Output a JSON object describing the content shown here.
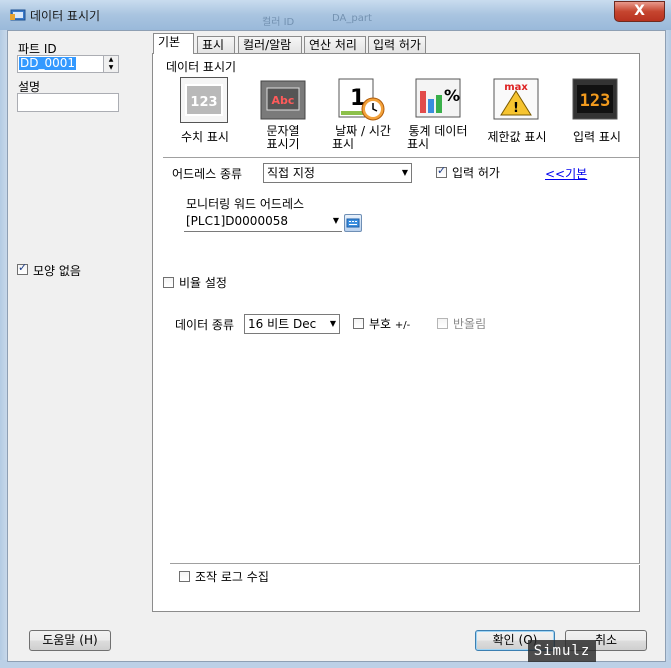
{
  "window": {
    "title": "데이터 표시기",
    "close": "X",
    "bg_ghost_1": "컬러 ID",
    "bg_ghost_2": "DA_part"
  },
  "left": {
    "part_id_label": "파트 ID",
    "part_id_value": "DD_0001",
    "desc_label": "설명",
    "desc_value": "",
    "no_shape_label": "모양 없음",
    "no_shape_checked": true
  },
  "tabs": [
    "기본",
    "표시",
    "컬러/알람",
    "연산 처리",
    "입력 허가"
  ],
  "basic": {
    "group_title": "데이터 표시기",
    "icons": [
      {
        "label1": "수치 표시",
        "label2": "",
        "glyph": "123"
      },
      {
        "label1": "문자열",
        "label2": "표시기",
        "glyph": "Abc"
      },
      {
        "label1": "날짜 / 시간",
        "label2": "표시",
        "glyph": "1"
      },
      {
        "label1": "통계 데이터",
        "label2": "표시",
        "glyph": "%"
      },
      {
        "label1": "제한값 표시",
        "label2": "",
        "glyph": "max"
      },
      {
        "label1": "입력 표시",
        "label2": "",
        "glyph": "123"
      }
    ],
    "address_type_label": "어드레스 종류",
    "address_type_value": "직접 지정",
    "input_allow_label": "입력 허가",
    "input_allow_checked": true,
    "basic_link": "<<기본",
    "monitor_word_label": "모니터링 워드 어드레스",
    "monitor_word_value": "[PLC1]D0000058",
    "scale_label": "비율 설정",
    "data_type_label": "데이터 종류",
    "data_type_value": "16 비트 Dec",
    "sign_label": "부호",
    "sign_suffix": "+/-",
    "round_label": "반올림",
    "op_log_label": "조작 로그 수집"
  },
  "footer": {
    "help": "도움말 (H)",
    "ok": "확인 (O)",
    "cancel": "취소"
  },
  "watermark": "Simulz"
}
